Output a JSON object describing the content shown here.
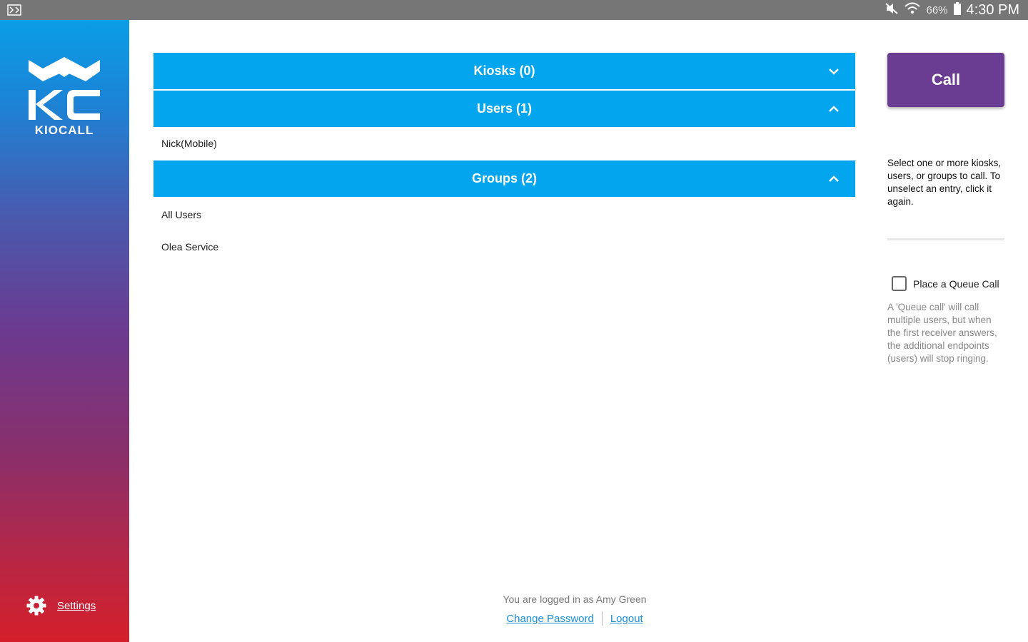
{
  "statusbar": {
    "battery": "66%",
    "time": "4:30 PM",
    "icons": [
      "notification-icon",
      "mute-icon",
      "wifi-icon",
      "battery-icon"
    ]
  },
  "sidebar": {
    "brand": "KIOCALL",
    "settings_label": "Settings",
    "gradient_top": "#0a9de6",
    "gradient_bottom": "#d41f2a"
  },
  "main": {
    "sections": [
      {
        "label": "Kiosks (0)",
        "expanded": false,
        "items": []
      },
      {
        "label": "Users (1)",
        "expanded": true,
        "items": [
          "Nick(Mobile)"
        ]
      },
      {
        "label": "Groups (2)",
        "expanded": true,
        "items": [
          "All Users",
          "Olea Service"
        ]
      }
    ],
    "header_color": "#03a5ee"
  },
  "right": {
    "call_label": "Call",
    "call_color": "#6a3d92",
    "instructions": "Select one or more kiosks, users, or groups to call. To unselect an entry, click it again.",
    "queue_label": "Place a Queue Call",
    "queue_checked": false,
    "queue_desc": "A 'Queue call' will call multiple users, but when the first receiver answers, the additional endpoints (users) will stop ringing."
  },
  "footer": {
    "logged_in": "You are logged in as Amy Green",
    "change_password": "Change Password",
    "logout": "Logout"
  }
}
